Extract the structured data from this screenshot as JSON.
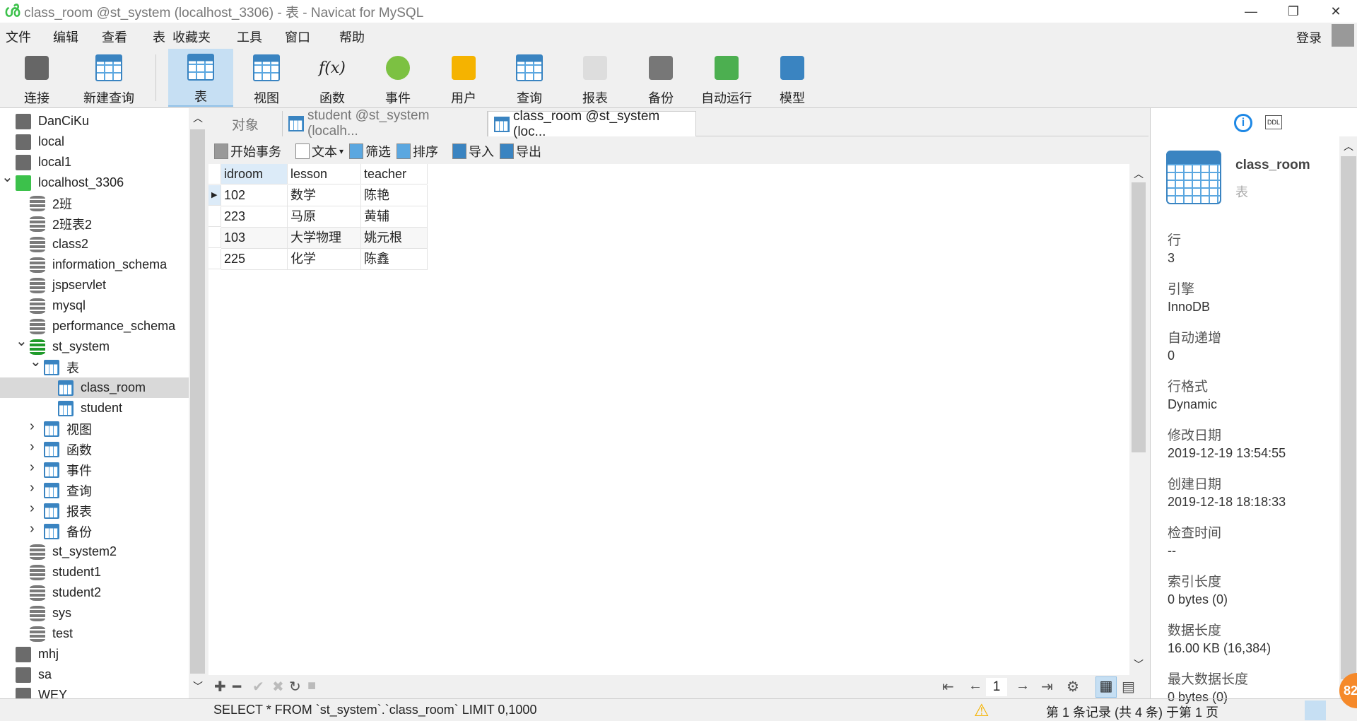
{
  "window": {
    "title": "class_room @st_system (localhost_3306) - 表 - Navicat for MySQL"
  },
  "menu": [
    "文件",
    "编辑",
    "查看",
    "表",
    "收藏夹",
    "工具",
    "窗口",
    "帮助"
  ],
  "login": "登录",
  "toolbar": [
    {
      "label": "连接",
      "icon": "connection-plug-icon"
    },
    {
      "label": "新建查询",
      "icon": "new-query-icon"
    },
    {
      "label": "表",
      "icon": "table-icon",
      "active": true
    },
    {
      "label": "视图",
      "icon": "view-icon"
    },
    {
      "label": "函数",
      "icon": "function-icon",
      "glyph": "f(x)"
    },
    {
      "label": "事件",
      "icon": "clock-icon"
    },
    {
      "label": "用户",
      "icon": "user-icon"
    },
    {
      "label": "查询",
      "icon": "query-icon"
    },
    {
      "label": "报表",
      "icon": "report-icon"
    },
    {
      "label": "备份",
      "icon": "backup-icon"
    },
    {
      "label": "自动运行",
      "icon": "schedule-icon"
    },
    {
      "label": "模型",
      "icon": "model-icon"
    }
  ],
  "tree": [
    {
      "label": "DanCiKu",
      "type": "conn",
      "level": 0
    },
    {
      "label": "local",
      "type": "conn",
      "level": 0
    },
    {
      "label": "local1",
      "type": "conn",
      "level": 0
    },
    {
      "label": "localhost_3306",
      "type": "conn-on",
      "level": 0,
      "expanded": true
    },
    {
      "label": "2班",
      "type": "db",
      "level": 1
    },
    {
      "label": "2班表2",
      "type": "db",
      "level": 1
    },
    {
      "label": "class2",
      "type": "db",
      "level": 1
    },
    {
      "label": "information_schema",
      "type": "db",
      "level": 1
    },
    {
      "label": "jspservlet",
      "type": "db",
      "level": 1
    },
    {
      "label": "mysql",
      "type": "db",
      "level": 1
    },
    {
      "label": "performance_schema",
      "type": "db",
      "level": 1
    },
    {
      "label": "st_system",
      "type": "db-on",
      "level": 1,
      "expanded": true
    },
    {
      "label": "表",
      "type": "tables",
      "level": 2,
      "expanded": true
    },
    {
      "label": "class_room",
      "type": "table",
      "level": 3,
      "selected": true
    },
    {
      "label": "student",
      "type": "table",
      "level": 3
    },
    {
      "label": "视图",
      "type": "views",
      "level": 2,
      "collapsed": true
    },
    {
      "label": "函数",
      "type": "functions",
      "level": 2,
      "collapsed": true
    },
    {
      "label": "事件",
      "type": "events",
      "level": 2,
      "collapsed": true
    },
    {
      "label": "查询",
      "type": "queries",
      "level": 2,
      "collapsed": true
    },
    {
      "label": "报表",
      "type": "reports",
      "level": 2,
      "collapsed": true
    },
    {
      "label": "备份",
      "type": "backups",
      "level": 2,
      "collapsed": true
    },
    {
      "label": "st_system2",
      "type": "db",
      "level": 1
    },
    {
      "label": "student1",
      "type": "db",
      "level": 1
    },
    {
      "label": "student2",
      "type": "db",
      "level": 1
    },
    {
      "label": "sys",
      "type": "db",
      "level": 1
    },
    {
      "label": "test",
      "type": "db",
      "level": 1
    },
    {
      "label": "mhj",
      "type": "conn",
      "level": 0
    },
    {
      "label": "sa",
      "type": "conn",
      "level": 0
    },
    {
      "label": "WEY",
      "type": "conn",
      "level": 0
    }
  ],
  "tabs": [
    {
      "label": "对象"
    },
    {
      "label": "student @st_system (localh..."
    },
    {
      "label": "class_room @st_system (loc...",
      "active": true
    }
  ],
  "data_toolbar": [
    "开始事务",
    "文本",
    "筛选",
    "排序",
    "导入",
    "导出"
  ],
  "grid": {
    "columns": [
      "idroom",
      "lesson",
      "teacher"
    ],
    "rows": [
      [
        "102",
        "数学",
        "陈艳"
      ],
      [
        "223",
        "马原",
        "黄辅"
      ],
      [
        "103",
        "大学物理",
        "姚元根"
      ],
      [
        "225",
        "化学",
        "陈鑫"
      ]
    ]
  },
  "pager": {
    "page": "1"
  },
  "status": {
    "sql": "SELECT * FROM `st_system`.`class_room` LIMIT 0,1000",
    "records": "第 1 条记录 (共 4 条) 于第 1 页"
  },
  "info": {
    "name": "class_room",
    "type": "表",
    "ddl_label": "DDL",
    "props": [
      {
        "label": "行",
        "value": "3"
      },
      {
        "label": "引擎",
        "value": "InnoDB"
      },
      {
        "label": "自动递增",
        "value": "0"
      },
      {
        "label": "行格式",
        "value": "Dynamic"
      },
      {
        "label": "修改日期",
        "value": "2019-12-19 13:54:55"
      },
      {
        "label": "创建日期",
        "value": "2019-12-18 18:18:33"
      },
      {
        "label": "检查时间",
        "value": "--"
      },
      {
        "label": "索引长度",
        "value": "0 bytes (0)"
      },
      {
        "label": "数据长度",
        "value": "16.00 KB (16,384)"
      },
      {
        "label": "最大数据长度",
        "value": "0 bytes (0)"
      }
    ]
  },
  "badge": "82",
  "colors": {
    "accent": "#3a84c1",
    "selected_tab": "#c6dff3",
    "connected": "#3cc14b"
  }
}
